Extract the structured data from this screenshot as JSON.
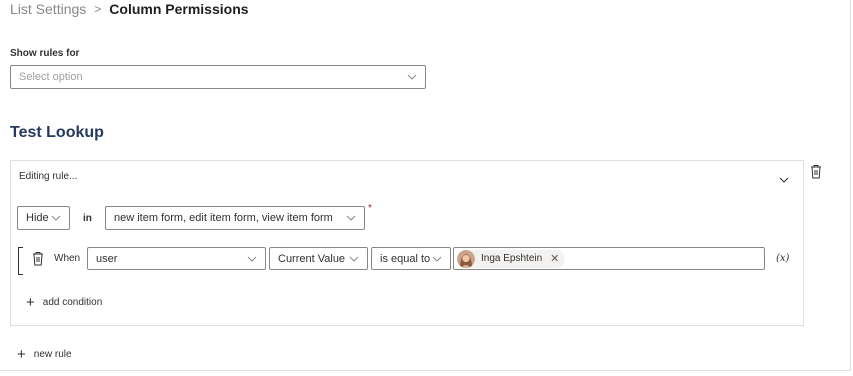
{
  "breadcrumb": {
    "parent": "List Settings",
    "separator": ">",
    "current": "Column Permissions"
  },
  "filter": {
    "label": "Show rules for",
    "placeholder": "Select option"
  },
  "section": {
    "title": "Test Lookup"
  },
  "rule": {
    "header": "Editing rule...",
    "action": "Hide",
    "in_label": "in",
    "forms": "new item form, edit item form, view item form",
    "required_marker": "*",
    "condition": {
      "when_label": "When",
      "subject": "user",
      "value_type": "Current Value",
      "operator": "is equal to",
      "person": "Inga Epshtein",
      "fx_label": "(x)"
    },
    "add_condition_label": "add condition"
  },
  "new_rule_label": "new rule",
  "icons": {
    "chevron": "chevron-down-icon",
    "trash": "trash-icon",
    "plus": "plus-icon",
    "remove": "close-icon"
  },
  "colors": {
    "section_title": "#243a5e",
    "required": "#a4262c",
    "border": "#8a8886"
  }
}
